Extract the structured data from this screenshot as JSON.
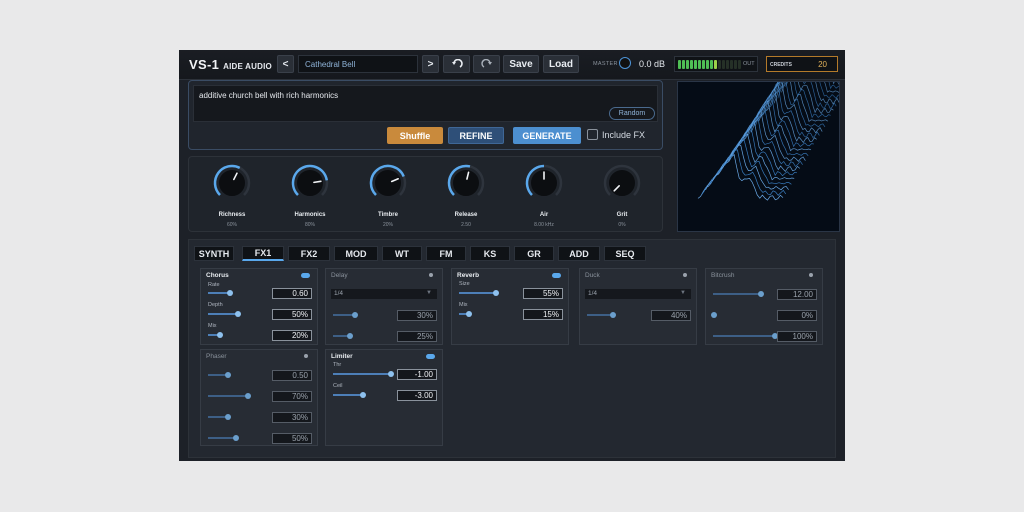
{
  "app": {
    "title": "VS-1",
    "subtitle": "AIDE AUDIO"
  },
  "header": {
    "prev_label": "<",
    "next_label": ">",
    "preset_name": "Cathedral Bell",
    "undo_icon": "undo-icon",
    "redo_icon": "redo-icon",
    "save_label": "Save",
    "load_label": "Load",
    "master_label": "MASTER",
    "master_db": "0.0 dB",
    "meter_label": "OUT",
    "meter_level": 0.6,
    "credits_label": "CREDITS",
    "credits_value": "20"
  },
  "prompt": {
    "text": "additive church bell with rich harmonics",
    "random_label": "Random",
    "shuffle_label": "Shuffle",
    "refine_label": "REFINE",
    "generate_label": "GENERATE",
    "include_fx_label": "Include FX",
    "include_fx_checked": false
  },
  "macros": [
    {
      "label": "Richness",
      "value": "60%",
      "level": 0.6
    },
    {
      "label": "Harmonics",
      "value": "80%",
      "level": 0.8
    },
    {
      "label": "Timbre",
      "value": "20%",
      "level": 0.75
    },
    {
      "label": "Release",
      "value": "2.50",
      "level": 0.55
    },
    {
      "label": "Air",
      "value": "8.00 kHz",
      "level": 0.5
    },
    {
      "label": "Grit",
      "value": "0%",
      "level": 0.0
    }
  ],
  "tabs": [
    {
      "label": "SYNTH",
      "active": false
    },
    {
      "label": "FX1",
      "active": true
    },
    {
      "label": "FX2",
      "active": false
    },
    {
      "label": "MOD",
      "active": false
    },
    {
      "label": "WT",
      "active": false
    },
    {
      "label": "FM",
      "active": false
    },
    {
      "label": "KS",
      "active": false
    },
    {
      "label": "GR",
      "active": false
    },
    {
      "label": "ADD",
      "active": false
    },
    {
      "label": "SEQ",
      "active": false
    }
  ],
  "fx": {
    "chorus": {
      "title": "Chorus",
      "enabled": true,
      "rate_label": "Rate",
      "rate_value": "0.60",
      "rate_level": 0.3,
      "depth_label": "Depth",
      "depth_value": "50%",
      "depth_level": 0.5,
      "mix_label": "Mix",
      "mix_value": "20%",
      "mix_level": 0.2
    },
    "delay": {
      "title": "Delay",
      "enabled": false,
      "division": "1/4",
      "feedback_value": "30%",
      "feedback_level": 0.3,
      "mix_value": "25%",
      "mix_level": 0.25
    },
    "reverb": {
      "title": "Reverb",
      "enabled": true,
      "size_label": "Size",
      "size_value": "55%",
      "size_level": 0.55,
      "mix_label": "Mix",
      "mix_value": "15%",
      "mix_level": 0.15
    },
    "duck": {
      "title": "Duck",
      "enabled": false,
      "division": "1/4",
      "depth_value": "40%",
      "depth_level": 0.4
    },
    "bitcrush": {
      "title": "Bitcrush",
      "enabled": false,
      "bits_value": "12.00",
      "bits_level": 0.75,
      "rate_value": "0%",
      "rate_level": 0.0,
      "mix_value": "100%",
      "mix_level": 1.0
    },
    "phaser": {
      "title": "Phaser",
      "enabled": false,
      "rate_value": "0.50",
      "rate_level": 0.3,
      "depth_value": "70%",
      "depth_level": 0.7,
      "feedback_value": "30%",
      "feedback_level": 0.3,
      "mix_value": "50%",
      "mix_level": 0.5
    },
    "limiter": {
      "title": "Limiter",
      "enabled": true,
      "thr_label": "Thr",
      "thr_value": "-1.00",
      "thr_level": 0.95,
      "ceil_label": "Ceil",
      "ceil_value": "-3.00",
      "ceil_level": 0.5
    }
  },
  "colors": {
    "accent": "#5aa8ec",
    "shuffle": "#c98a3c",
    "refine": "#2e4f78",
    "generate": "#4c8fd0",
    "credits_border": "#b47a2a"
  }
}
